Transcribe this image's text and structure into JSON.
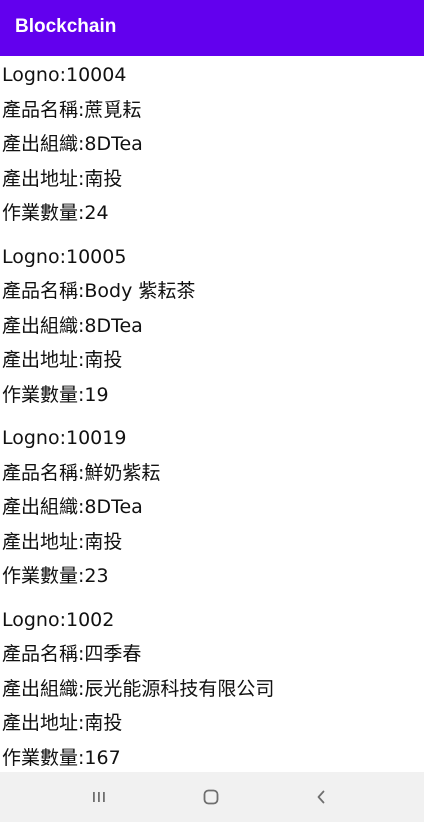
{
  "app_bar": {
    "title": "Blockchain",
    "color": "#6200EE"
  },
  "records": [
    {
      "logno": "Logno:10004",
      "product_name": "產品名稱:蔗覓耘",
      "organization": "產出組織:8DTea",
      "address": "產出地址:南投",
      "quantity": "作業數量:24"
    },
    {
      "logno": "Logno:10005",
      "product_name": "產品名稱:Body 紫耘茶",
      "organization": "產出組織:8DTea",
      "address": "產出地址:南投",
      "quantity": "作業數量:19"
    },
    {
      "logno": "Logno:10019",
      "product_name": "產品名稱:鮮奶紫耘",
      "organization": "產出組織:8DTea",
      "address": "產出地址:南投",
      "quantity": "作業數量:23"
    },
    {
      "logno": "Logno:1002",
      "product_name": "產品名稱:四季春",
      "organization": "產出組織:辰光能源科技有限公司",
      "address": "產出地址:南投",
      "quantity": "作業數量:167"
    }
  ],
  "nav_bar": {
    "recents_icon": "recent-apps-icon",
    "home_icon": "home-icon",
    "back_icon": "back-icon"
  }
}
